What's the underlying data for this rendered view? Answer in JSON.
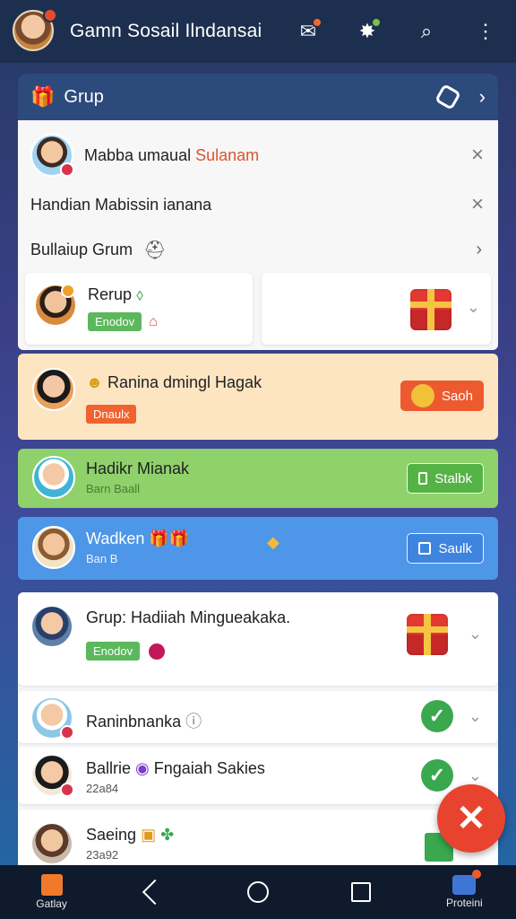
{
  "app": {
    "title": "Gamn Sosail Ilndansai"
  },
  "group_header": {
    "label": "Grup"
  },
  "panel_top": {
    "row1": {
      "name_part": "Mabba umaual ",
      "name_accent": "Sulanam"
    },
    "row2": {
      "name": "Handian Mabissin ianana"
    },
    "row3": {
      "name": "Bullaiup Grum"
    },
    "card_left": {
      "title": "Rerup",
      "tag": "Enodov"
    }
  },
  "cards": {
    "peach": {
      "title": "Ranina dmingl Hagak",
      "tag": "Dnaulx",
      "button": "Saoh"
    },
    "green": {
      "title": "Hadikr Mianak",
      "sub": "Barn Baall",
      "button": "Stalbk"
    },
    "blue": {
      "title": "Wadken",
      "sub": "Ban B",
      "button": "Saulk"
    }
  },
  "list": {
    "row1": {
      "title": "Grup: Hadiiah Mingueakaka.",
      "tag": "Enodov"
    },
    "row2": {
      "title": "Raninbnanka"
    },
    "row3": {
      "title": "Ballrie",
      "title2": "Fngaiah Sakies",
      "sub": "22a84"
    },
    "row4": {
      "title": "Saeing",
      "sub": "23a92"
    }
  },
  "bottom_nav": {
    "left_label": "Gatlay",
    "right_label": "Proteini"
  },
  "colors": {
    "topbar": "#1d2f4f",
    "accent_orange": "#ee5a2f",
    "peach_card": "#fde5c2",
    "green_card": "#8fd16a",
    "blue_card": "#4d96e8"
  }
}
